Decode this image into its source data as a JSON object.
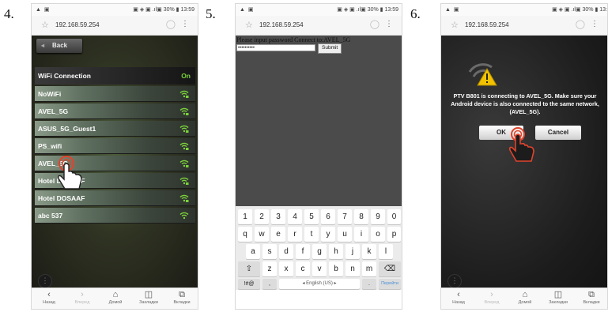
{
  "steps": [
    "4.",
    "5.",
    "6."
  ],
  "status": {
    "left": "▲ ▣",
    "right": "▣ ◈ ▣ .ıl▣ 30% ▮ 13:59",
    "right_cut": "▣ ◈ ▣ .ıl▣ 30% ▮ 13:"
  },
  "browser": {
    "url": "192.168.59.254",
    "nav": [
      "Назад",
      "Вперед",
      "Домой",
      "Закладки",
      "Вкладки"
    ]
  },
  "wifi_screen": {
    "back_label": "Back",
    "header": "WiFi Connection",
    "status": "On",
    "networks": [
      "NoWiFi",
      "AVEL_5G",
      "ASUS_5G_Guest1",
      "PS_wifi",
      "AVEL_5G",
      "Hotel DOSAAF",
      "Hotel DOSAAF",
      "abc 537"
    ]
  },
  "password_screen": {
    "prompt": "Please input password Connect to:AVEL_5G",
    "password_value": "••••••••••",
    "submit_label": "Submit",
    "keyboard": {
      "row1": [
        "1",
        "2",
        "3",
        "4",
        "5",
        "6",
        "7",
        "8",
        "9",
        "0"
      ],
      "row2": [
        "q",
        "w",
        "e",
        "r",
        "t",
        "y",
        "u",
        "i",
        "o",
        "p"
      ],
      "row3": [
        "a",
        "s",
        "d",
        "f",
        "g",
        "h",
        "j",
        "k",
        "l"
      ],
      "row4": [
        "⇧",
        "z",
        "x",
        "c",
        "v",
        "b",
        "n",
        "m",
        "⌫"
      ],
      "symbols": "!#@",
      "comma": ",",
      "space": "◂ English (US) ▸",
      "period": ".",
      "go": "Перейти"
    }
  },
  "confirm_screen": {
    "message": "PTV B801 is connecting to AVEL_5G. Make sure your Android device is also connected to the same network, (AVEL_5G).",
    "ok_label": "OK",
    "cancel_label": "Cancel"
  },
  "colors": {
    "wifi_green": "#7cd23a",
    "touch_red": "#e0442c",
    "warning_yellow": "#f2c200"
  }
}
